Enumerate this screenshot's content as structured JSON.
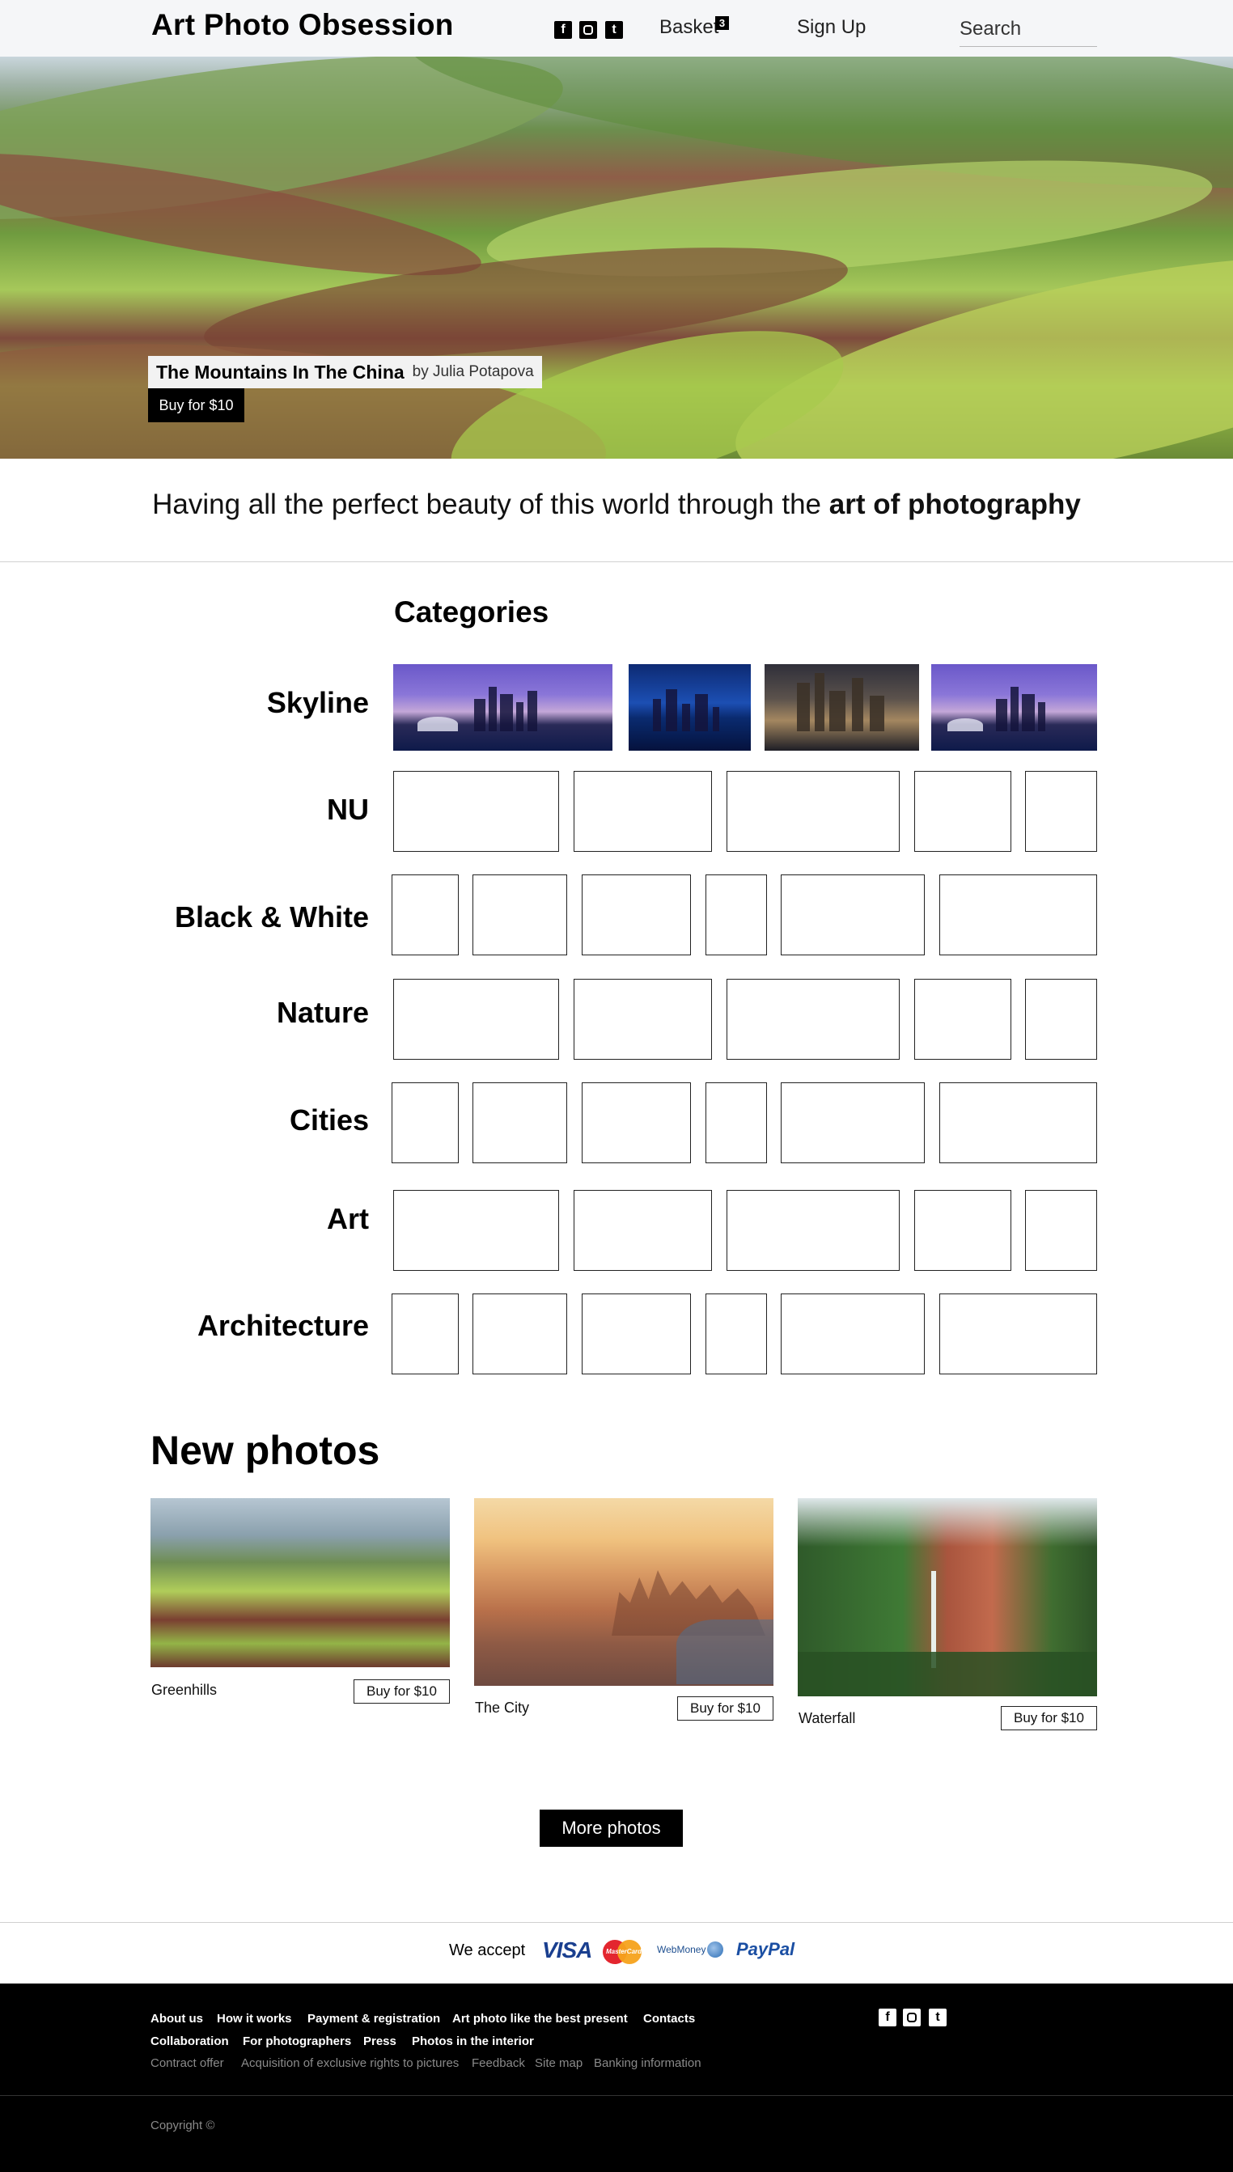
{
  "header": {
    "logo": "Art Photo Obsession",
    "social": [
      {
        "icon": "facebook-icon",
        "glyph": "f"
      },
      {
        "icon": "instagram-icon",
        "glyph": ""
      },
      {
        "icon": "tumblr-icon",
        "glyph": "t"
      }
    ],
    "basket_label": "Basket",
    "basket_count": "3",
    "signup_label": "Sign Up",
    "search_placeholder": "Search"
  },
  "hero": {
    "title": "The Mountains In The China",
    "author": "by Julia Potapova",
    "buy_label": "Buy for $10"
  },
  "tagline": {
    "text": "Having all the perfect beauty of this world through the ",
    "emphasis": "art of photography"
  },
  "categories": {
    "title": "Categories",
    "rows": [
      {
        "label": "Skyline"
      },
      {
        "label": "NU"
      },
      {
        "label": "Black & White"
      },
      {
        "label": "Nature"
      },
      {
        "label": "Cities"
      },
      {
        "label": "Art"
      },
      {
        "label": "Architecture"
      }
    ]
  },
  "new_photos": {
    "title": "New photos",
    "items": [
      {
        "label": "Greenhills",
        "buy_label": "Buy for $10"
      },
      {
        "label": "The City",
        "buy_label": "Buy for $10"
      },
      {
        "label": "Waterfall",
        "buy_label": "Buy for $10"
      }
    ],
    "more_label": "More photos"
  },
  "payments": {
    "accept_label": "We accept",
    "methods": [
      "VISA",
      "MasterCard",
      "WebMoney",
      "PayPal"
    ]
  },
  "footer": {
    "links_row1": [
      "About us",
      "How it works",
      "Payment & registration",
      "Art photo like the best present",
      "Contacts"
    ],
    "links_row2": [
      "Collaboration",
      "For photographers",
      "Press",
      "Photos in the interior"
    ],
    "links_row3": [
      "Contract offer",
      "Acquisition of exclusive rights to pictures",
      "Feedback",
      "Site map",
      "Banking information"
    ],
    "copyright": "Copyright ©"
  },
  "colors": {
    "accent": "#000000",
    "header_bg": "#f5f6f8",
    "footer_bg": "#000000"
  }
}
